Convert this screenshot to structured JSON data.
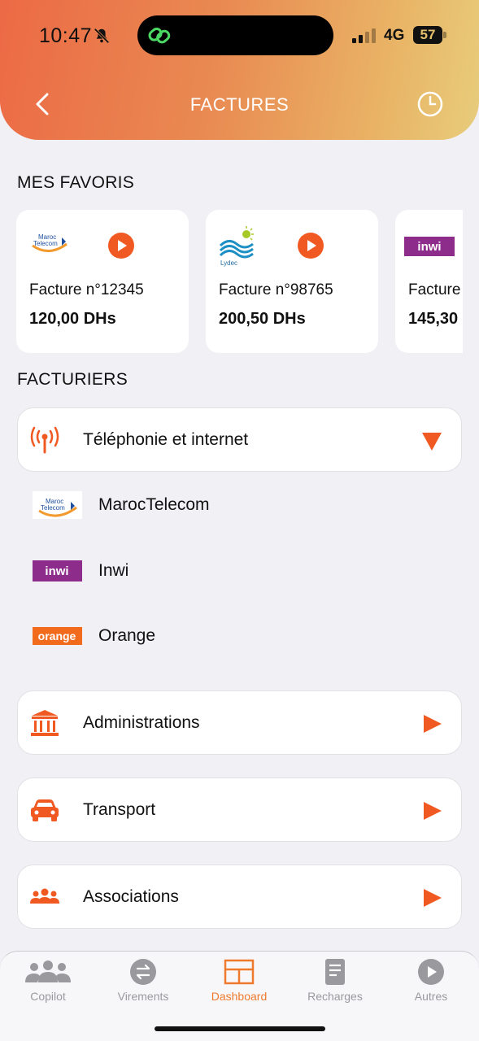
{
  "status_bar": {
    "time": "10:47",
    "network": "4G",
    "battery": "57",
    "icons": [
      "bell-slash-icon",
      "link-icon",
      "signal-icon",
      "battery-icon"
    ]
  },
  "header": {
    "title": "FACTURES",
    "back_icon": "chevron-left-icon",
    "history_icon": "clock-icon"
  },
  "favorites": {
    "title": "MES FAVORIS",
    "items": [
      {
        "logo": "Maroc Telecom",
        "number": "Facture n°12345",
        "amount": "120,00 DHs"
      },
      {
        "logo": "Lydec",
        "number": "Facture n°98765",
        "amount": "200,50 DHs"
      },
      {
        "logo": "inwi",
        "number": "Facture n°",
        "amount": "145,30"
      }
    ]
  },
  "billers": {
    "title": "FACTURIERS",
    "categories": [
      {
        "label": "Téléphonie et internet",
        "icon": "antenna-icon",
        "expanded": true
      },
      {
        "label": "Administrations",
        "icon": "bank-icon",
        "expanded": false
      },
      {
        "label": "Transport",
        "icon": "car-icon",
        "expanded": false
      },
      {
        "label": "Associations",
        "icon": "people-icon",
        "expanded": false
      }
    ],
    "sub_items": [
      {
        "label": "MarocTelecom",
        "logo": "Maroc Telecom"
      },
      {
        "label": "Inwi",
        "logo": "inwi"
      },
      {
        "label": "Orange",
        "logo": "orange"
      }
    ]
  },
  "bottom_nav": {
    "items": [
      {
        "label": "Copilot",
        "icon": "people-icon"
      },
      {
        "label": "Virements",
        "icon": "transfer-icon"
      },
      {
        "label": "Dashboard",
        "icon": "grid-icon",
        "active": true
      },
      {
        "label": "Recharges",
        "icon": "document-icon"
      },
      {
        "label": "Autres",
        "icon": "play-icon"
      }
    ]
  },
  "colors": {
    "accent": "#f05a22",
    "header_gradient_start": "#ec6a45",
    "header_gradient_end": "#e7cd7c",
    "inwi": "#8e2c8c",
    "orange": "#f26b1d"
  }
}
